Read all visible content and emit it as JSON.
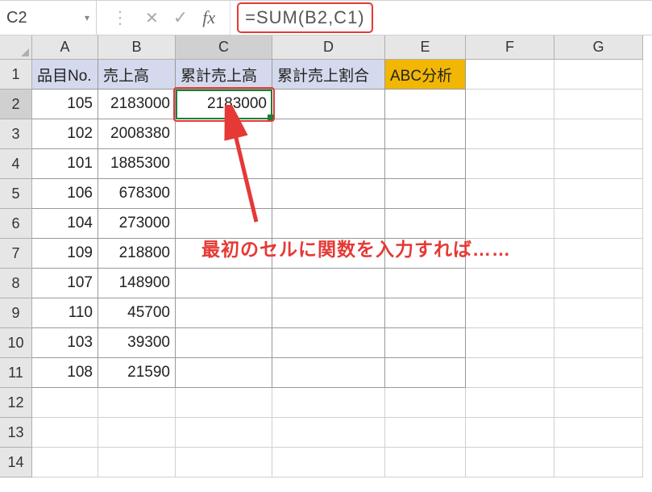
{
  "formula_bar": {
    "name_box": "C2",
    "formula": "=SUM(B2,C1)"
  },
  "icons": {
    "dropdown": "▾",
    "dots": "⋮",
    "cancel": "✕",
    "confirm": "✓",
    "fx": "fx"
  },
  "columns": [
    "A",
    "B",
    "C",
    "D",
    "E",
    "F",
    "G"
  ],
  "row_labels": [
    "1",
    "2",
    "3",
    "4",
    "5",
    "6",
    "7",
    "8",
    "9",
    "10",
    "11",
    "12",
    "13",
    "14"
  ],
  "headers": {
    "A": "品目No.",
    "B": "売上高",
    "C": "累計売上高",
    "D": "累計売上割合",
    "E": "ABC分析"
  },
  "rows": [
    {
      "A": "105",
      "B": "2183000",
      "C": "2183000"
    },
    {
      "A": "102",
      "B": "2008380"
    },
    {
      "A": "101",
      "B": "1885300"
    },
    {
      "A": "106",
      "B": "678300"
    },
    {
      "A": "104",
      "B": "273000"
    },
    {
      "A": "109",
      "B": "218800"
    },
    {
      "A": "107",
      "B": "148900"
    },
    {
      "A": "110",
      "B": "45700"
    },
    {
      "A": "103",
      "B": "39300"
    },
    {
      "A": "108",
      "B": "21590"
    }
  ],
  "selected_cell": "C2",
  "annotation_text": "最初のセルに関数を入力すれば……",
  "colors": {
    "highlight_red": "#e53935",
    "selection_green": "#1a7f37",
    "header_blue": "#d5d9ed",
    "header_orange": "#f2b705"
  }
}
